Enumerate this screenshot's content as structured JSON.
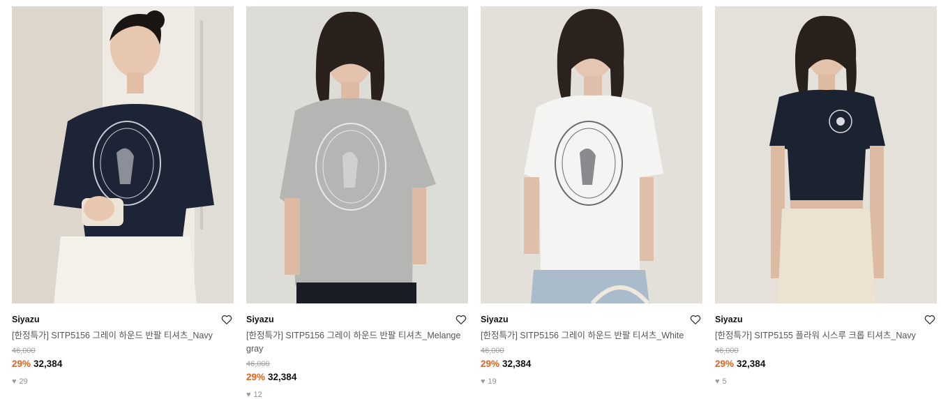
{
  "products": [
    {
      "brand": "Siyazu",
      "name": "[한정특가] SITP5156 그레이 하운드 반팔 티셔츠_Navy",
      "original_price": "46,000",
      "discount": "29%",
      "price": "32,384",
      "likes": "29",
      "shirt_color": "#1d2436"
    },
    {
      "brand": "Siyazu",
      "name": "[한정특가] SITP5156 그레이 하운드 반팔 티셔츠_Melange gray",
      "original_price": "46,000",
      "discount": "29%",
      "price": "32,384",
      "likes": "12",
      "shirt_color": "#b5b5b3"
    },
    {
      "brand": "Siyazu",
      "name": "[한정특가] SITP5156 그레이 하운드 반팔 티셔츠_White",
      "original_price": "46,000",
      "discount": "29%",
      "price": "32,384",
      "likes": "19",
      "shirt_color": "#f4f4f2"
    },
    {
      "brand": "Siyazu",
      "name": "[한정특가] SITP5155 플라워 시스루 크롭 티셔츠_Navy",
      "original_price": "46,000",
      "discount": "29%",
      "price": "32,384",
      "likes": "5",
      "shirt_color": "#1b2230"
    }
  ],
  "icons": {
    "wishlist": "heart-outline-icon",
    "likes": "heart-filled-icon"
  },
  "colors": {
    "discount": "#e8601c",
    "brand_text": "#111111",
    "name_text": "#555555"
  }
}
